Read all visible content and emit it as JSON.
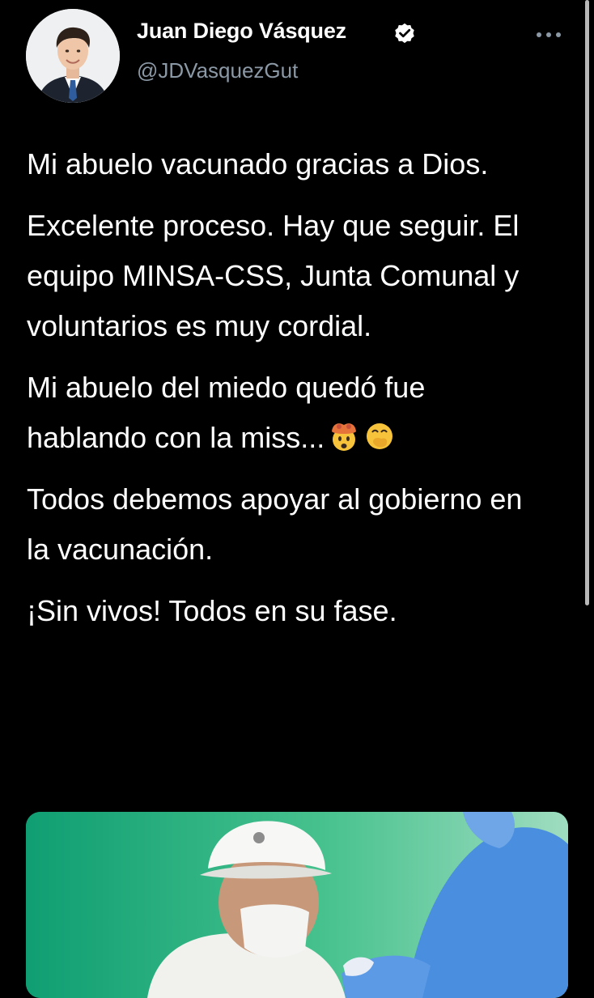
{
  "author": {
    "name": "Juan Diego Vásquez",
    "handle": "@JDVasquezGut",
    "verified": true
  },
  "tweet": {
    "paragraphs": [
      "Mi abuelo vacunado gracias a Dios.",
      "Excelente proceso. Hay que seguir. El equipo MINSA-CSS, Junta Comunal y voluntarios es muy cordial.",
      "Mi abuelo del miedo quedó fue hablando con la miss...",
      "Todos debemos apoyar al gobierno en la vacunación.",
      "¡Sin vivos! Todos en su fase."
    ],
    "emojis": [
      "exploding-head-emoji",
      "face-with-hand-over-mouth-emoji"
    ]
  },
  "icons": {
    "verified": "verified-badge-icon",
    "more": "more-options-icon"
  },
  "colors": {
    "background": "#000000",
    "text": "#ffffff",
    "handle": "#8b98a5",
    "verified_badge": "#ffffff"
  }
}
